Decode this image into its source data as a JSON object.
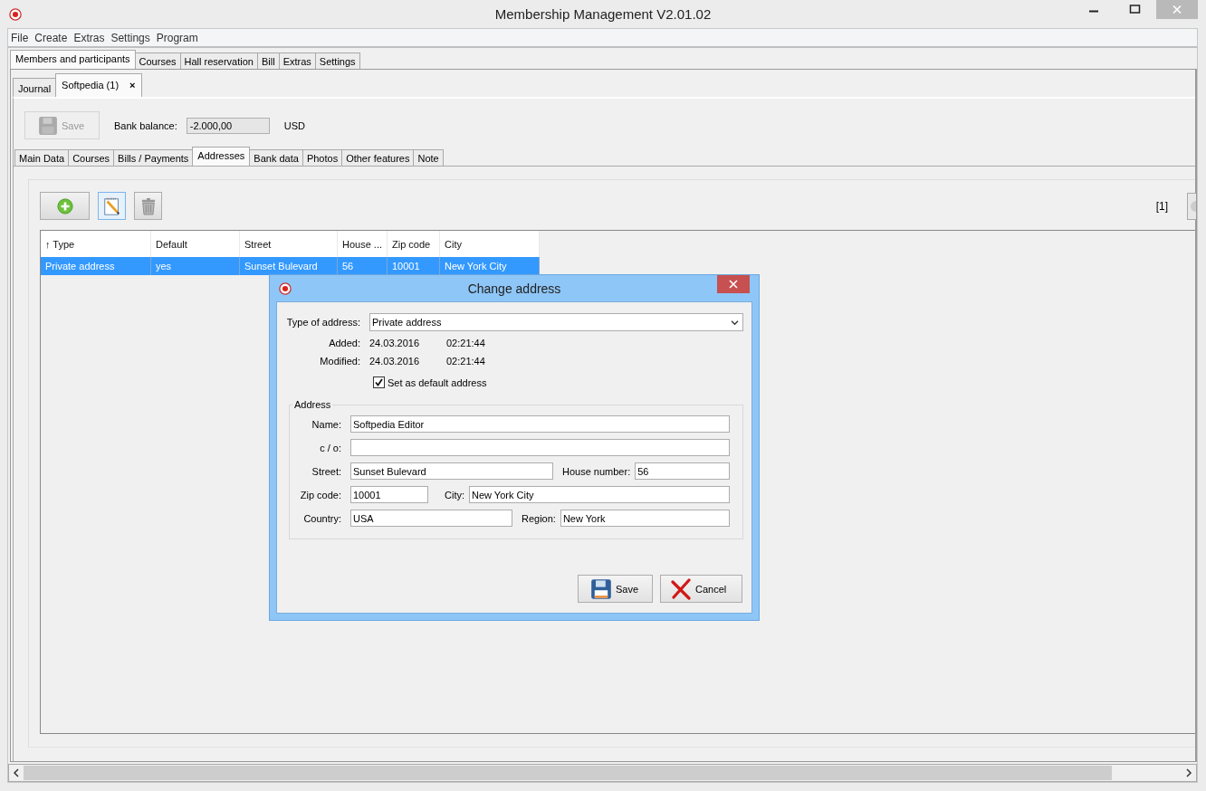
{
  "window": {
    "title": "Membership Management V2.01.02"
  },
  "menu": [
    "File",
    "Create",
    "Extras",
    "Settings",
    "Program"
  ],
  "main_tabs": [
    {
      "label": "Members and participants",
      "selected": true
    },
    {
      "label": "Courses",
      "selected": false
    },
    {
      "label": "Hall reservation",
      "selected": false
    },
    {
      "label": "Bill",
      "selected": false
    },
    {
      "label": "Extras",
      "selected": false
    },
    {
      "label": "Settings",
      "selected": false
    }
  ],
  "record_tabs": [
    {
      "label": "Journal",
      "selected": false
    },
    {
      "label": "Softpedia (1)",
      "selected": true,
      "close_glyph": "×"
    }
  ],
  "toolbar": {
    "save": {
      "label": "Save",
      "disabled": true
    },
    "bank_balance_label": "Bank balance:",
    "bank_balance": "-2.000,00",
    "currency": "USD"
  },
  "detail_tabs": [
    {
      "label": "Main Data",
      "selected": false
    },
    {
      "label": "Courses",
      "selected": false
    },
    {
      "label": "Bills / Payments",
      "selected": false
    },
    {
      "label": "Addresses",
      "selected": true
    },
    {
      "label": "Bank data",
      "selected": false
    },
    {
      "label": "Photos",
      "selected": false
    },
    {
      "label": "Other features",
      "selected": false
    },
    {
      "label": "Note",
      "selected": false
    }
  ],
  "addresses": {
    "page_indicator": "[1]",
    "columns": [
      {
        "label": "Type",
        "sort_mark": "↑"
      },
      {
        "label": "Default"
      },
      {
        "label": "Street"
      },
      {
        "label": "House ..."
      },
      {
        "label": "Zip code"
      },
      {
        "label": "City"
      }
    ],
    "rows": [
      {
        "selected": true,
        "cells": [
          "Private address",
          "yes",
          "Sunset Bulevard",
          "56",
          "10001",
          "New York City"
        ]
      }
    ]
  },
  "dialog": {
    "title": "Change address",
    "type_label": "Type of address:",
    "type_value": "Private address",
    "stamps": [
      {
        "label": "Added:",
        "date": "24.03.2016",
        "time": "02:21:44"
      },
      {
        "label": "Modified:",
        "date": "24.03.2016",
        "time": "02:21:44"
      }
    ],
    "default_checkbox": {
      "label": "Set as default address",
      "checked": true
    },
    "group_label": "Address",
    "address_rows": [
      {
        "fields": [
          {
            "label": "Name:",
            "value": "Softpedia Editor"
          }
        ]
      },
      {
        "fields": [
          {
            "label": "c / o:"
          }
        ]
      },
      {
        "fields": [
          {
            "label": "Street:",
            "value": "Sunset Bulevard"
          },
          {
            "label": "House number:",
            "value": "56"
          }
        ]
      },
      {
        "fields": [
          {
            "label": "Zip code:",
            "value": "10001"
          },
          {
            "label": "City:",
            "value": "New York City"
          }
        ]
      },
      {
        "fields": [
          {
            "label": "Country:",
            "value": "USA"
          },
          {
            "label": "Region:",
            "value": "New York"
          }
        ]
      }
    ],
    "buttons": [
      {
        "kind": "save",
        "label": "Save"
      },
      {
        "kind": "cancel",
        "label": "Cancel"
      }
    ]
  }
}
